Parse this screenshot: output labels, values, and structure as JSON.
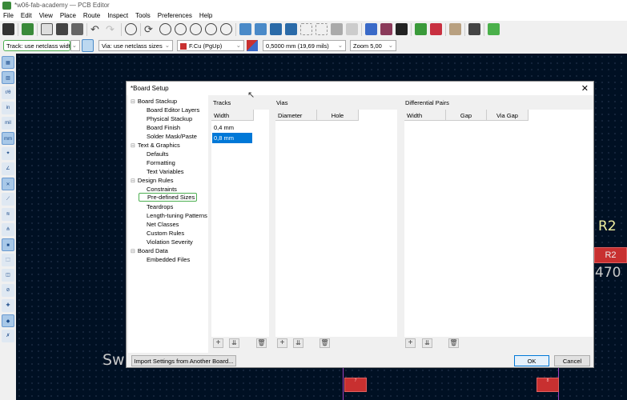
{
  "window": {
    "title": "*w06-fab-academy — PCB Editor"
  },
  "menu": [
    "File",
    "Edit",
    "View",
    "Place",
    "Route",
    "Inspect",
    "Tools",
    "Preferences",
    "Help"
  ],
  "toolbar2": {
    "track": "Track: use netclass width",
    "via": "Via: use netclass sizes",
    "layer": "F.Cu (PgUp)",
    "grid": "0,5000 mm (19,69 mils)",
    "zoom": "Zoom 5,00",
    "layer_color": "#c83030"
  },
  "left_toolbar": {
    "in": "in",
    "mil": "mil",
    "mm": "mm"
  },
  "canvas": {
    "ref_label": "R2",
    "pad_ref": "R2",
    "value_label": "470",
    "bg_text": "Swi",
    "pad7": "7",
    "pad8": "8"
  },
  "dialog": {
    "title": "*Board Setup",
    "tree": [
      {
        "label": "Board Stackup",
        "level": 0
      },
      {
        "label": "Board Editor Layers",
        "level": 1
      },
      {
        "label": "Physical Stackup",
        "level": 1
      },
      {
        "label": "Board Finish",
        "level": 1
      },
      {
        "label": "Solder Mask/Paste",
        "level": 1
      },
      {
        "label": "Text & Graphics",
        "level": 0
      },
      {
        "label": "Defaults",
        "level": 1
      },
      {
        "label": "Formatting",
        "level": 1
      },
      {
        "label": "Text Variables",
        "level": 1
      },
      {
        "label": "Design Rules",
        "level": 0
      },
      {
        "label": "Constraints",
        "level": 1
      },
      {
        "label": "Pre-defined Sizes",
        "level": 1
      },
      {
        "label": "Teardrops",
        "level": 1
      },
      {
        "label": "Length-tuning Patterns",
        "level": 1
      },
      {
        "label": "Net Classes",
        "level": 1
      },
      {
        "label": "Custom Rules",
        "level": 1
      },
      {
        "label": "Violation Severity",
        "level": 1
      },
      {
        "label": "Board Data",
        "level": 0
      },
      {
        "label": "Embedded Files",
        "level": 1
      }
    ],
    "tracks": {
      "title": "Tracks",
      "columns": [
        "Width"
      ],
      "rows": [
        "0,4 mm",
        "0,8 mm"
      ]
    },
    "vias": {
      "title": "Vias",
      "columns": [
        "Diameter",
        "Hole"
      ]
    },
    "diff_pairs": {
      "title": "Differential Pairs",
      "columns": [
        "Width",
        "Gap",
        "Via Gap"
      ]
    },
    "import_button": "Import Settings from Another Board...",
    "ok": "OK",
    "cancel": "Cancel"
  }
}
